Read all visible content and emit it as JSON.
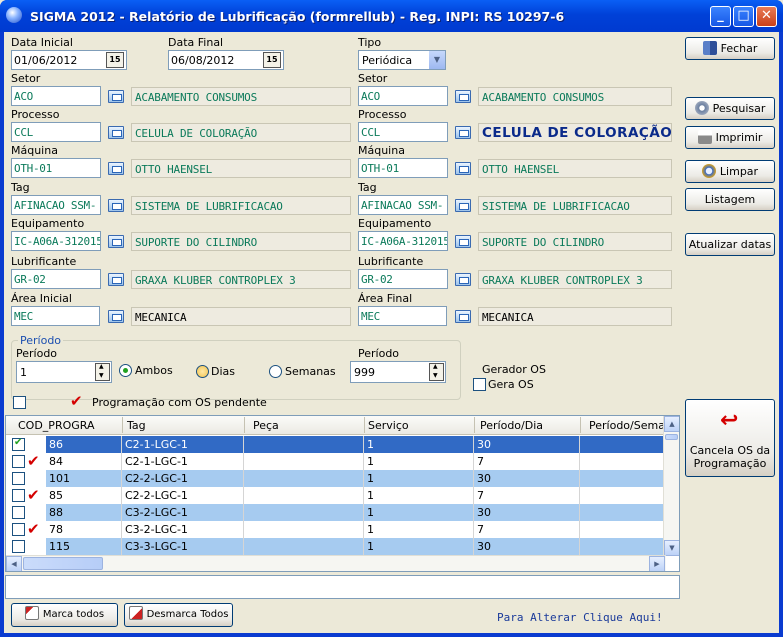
{
  "window": {
    "title": "SIGMA 2012 - Relatório de Lubrificação  (formrellub)  - Reg. INPI: RS 10297-6",
    "min": "_",
    "max": "□",
    "close": "✕"
  },
  "filters": {
    "data_inicial_label": "Data Inicial",
    "data_inicial": "01/06/2012",
    "data_final_label": "Data Final",
    "data_final": "06/08/2012",
    "cal_icon": "15",
    "tipo_label": "Tipo",
    "tipo": "Periódica",
    "left": [
      {
        "label": "Setor",
        "code": "ACO",
        "desc": "ACABAMENTO CONSUMOS"
      },
      {
        "label": "Processo",
        "code": "CCL",
        "desc": "CELULA DE COLORAÇÃO"
      },
      {
        "label": "Máquina",
        "code": "OTH-01",
        "desc": "OTTO HAENSEL"
      },
      {
        "label": "Tag",
        "code": "AFINACAO SSM-",
        "desc": "SISTEMA DE LUBRIFICACAO"
      },
      {
        "label": "Equipamento",
        "code": "IC-A06A-312015",
        "desc": "SUPORTE DO CILINDRO"
      },
      {
        "label": "Lubrificante",
        "code": "GR-02",
        "desc": "GRAXA KLUBER  CONTROPLEX 3"
      },
      {
        "label": "Área Inicial",
        "code": "MEC",
        "desc": "MECANICA"
      }
    ],
    "right": [
      {
        "label": "Setor",
        "code": "ACO",
        "desc": "ACABAMENTO CONSUMOS"
      },
      {
        "label": "Processo",
        "code": "CCL",
        "desc": "CELULA DE COLORAÇÃO"
      },
      {
        "label": "Máquina",
        "code": "OTH-01",
        "desc": "OTTO HAENSEL"
      },
      {
        "label": "Tag",
        "code": "AFINACAO SSM-",
        "desc": "SISTEMA DE LUBRIFICACAO"
      },
      {
        "label": "Equipamento",
        "code": "IC-A06A-312015",
        "desc": "SUPORTE DO CILINDRO"
      },
      {
        "label": "Lubrificante",
        "code": "GR-02",
        "desc": "GRAXA KLUBER  CONTROPLEX 3"
      },
      {
        "label": "Área Final",
        "code": "MEC",
        "desc": "MECANICA"
      }
    ]
  },
  "periodo": {
    "group_label": "Período",
    "label1": "Período",
    "value1": "1",
    "opt_ambos": "Ambos",
    "opt_dias": "Dias",
    "opt_semanas": "Semanas",
    "selected": "Ambos",
    "label2": "Período",
    "value2": "999",
    "gerador_label": "Gerador OS",
    "gera_os": "Gera OS",
    "pendente_label": "Programação com OS pendente"
  },
  "buttons": {
    "fechar": "Fechar",
    "pesquisar": "Pesquisar",
    "imprimir": "Imprimir",
    "limpar": "Limpar",
    "listagem": "Listagem",
    "atualizar": "Atualizar datas",
    "cancela": "Cancela OS da Programação",
    "marca": "Marca todos",
    "desmarca": "Desmarca Todos"
  },
  "grid": {
    "headers": [
      "COD_PROGRA",
      "Tag",
      "Peça",
      "Serviço",
      "Período/Dia",
      "Período/Semar"
    ],
    "rows": [
      {
        "checked": true,
        "tick": false,
        "cod": "86",
        "tag": "C2-1-LGC-1",
        "peca": "",
        "servico": "1",
        "dia": "30",
        "sem": "",
        "style": "selected"
      },
      {
        "checked": false,
        "tick": true,
        "cod": "84",
        "tag": "C2-1-LGC-1",
        "peca": "",
        "servico": "1",
        "dia": "7",
        "sem": "",
        "style": "white"
      },
      {
        "checked": false,
        "tick": false,
        "cod": "101",
        "tag": "C2-2-LGC-1",
        "peca": "",
        "servico": "1",
        "dia": "30",
        "sem": "",
        "style": "blue"
      },
      {
        "checked": false,
        "tick": true,
        "cod": "85",
        "tag": "C2-2-LGC-1",
        "peca": "",
        "servico": "1",
        "dia": "7",
        "sem": "",
        "style": "white"
      },
      {
        "checked": false,
        "tick": false,
        "cod": "88",
        "tag": "C3-2-LGC-1",
        "peca": "",
        "servico": "1",
        "dia": "30",
        "sem": "",
        "style": "blue"
      },
      {
        "checked": false,
        "tick": true,
        "cod": "78",
        "tag": "C3-2-LGC-1",
        "peca": "",
        "servico": "1",
        "dia": "7",
        "sem": "",
        "style": "white"
      },
      {
        "checked": false,
        "tick": false,
        "cod": "115",
        "tag": "C3-3-LGC-1",
        "peca": "",
        "servico": "1",
        "dia": "30",
        "sem": "",
        "style": "blue"
      }
    ]
  },
  "status_text": "",
  "footer_link": "Para Alterar Clique Aqui!",
  "colors": {
    "selected": "#316ac5",
    "blue_row": "#a6cbf0",
    "link": "#1a3a9a",
    "code_text": "#0b7a5a"
  }
}
